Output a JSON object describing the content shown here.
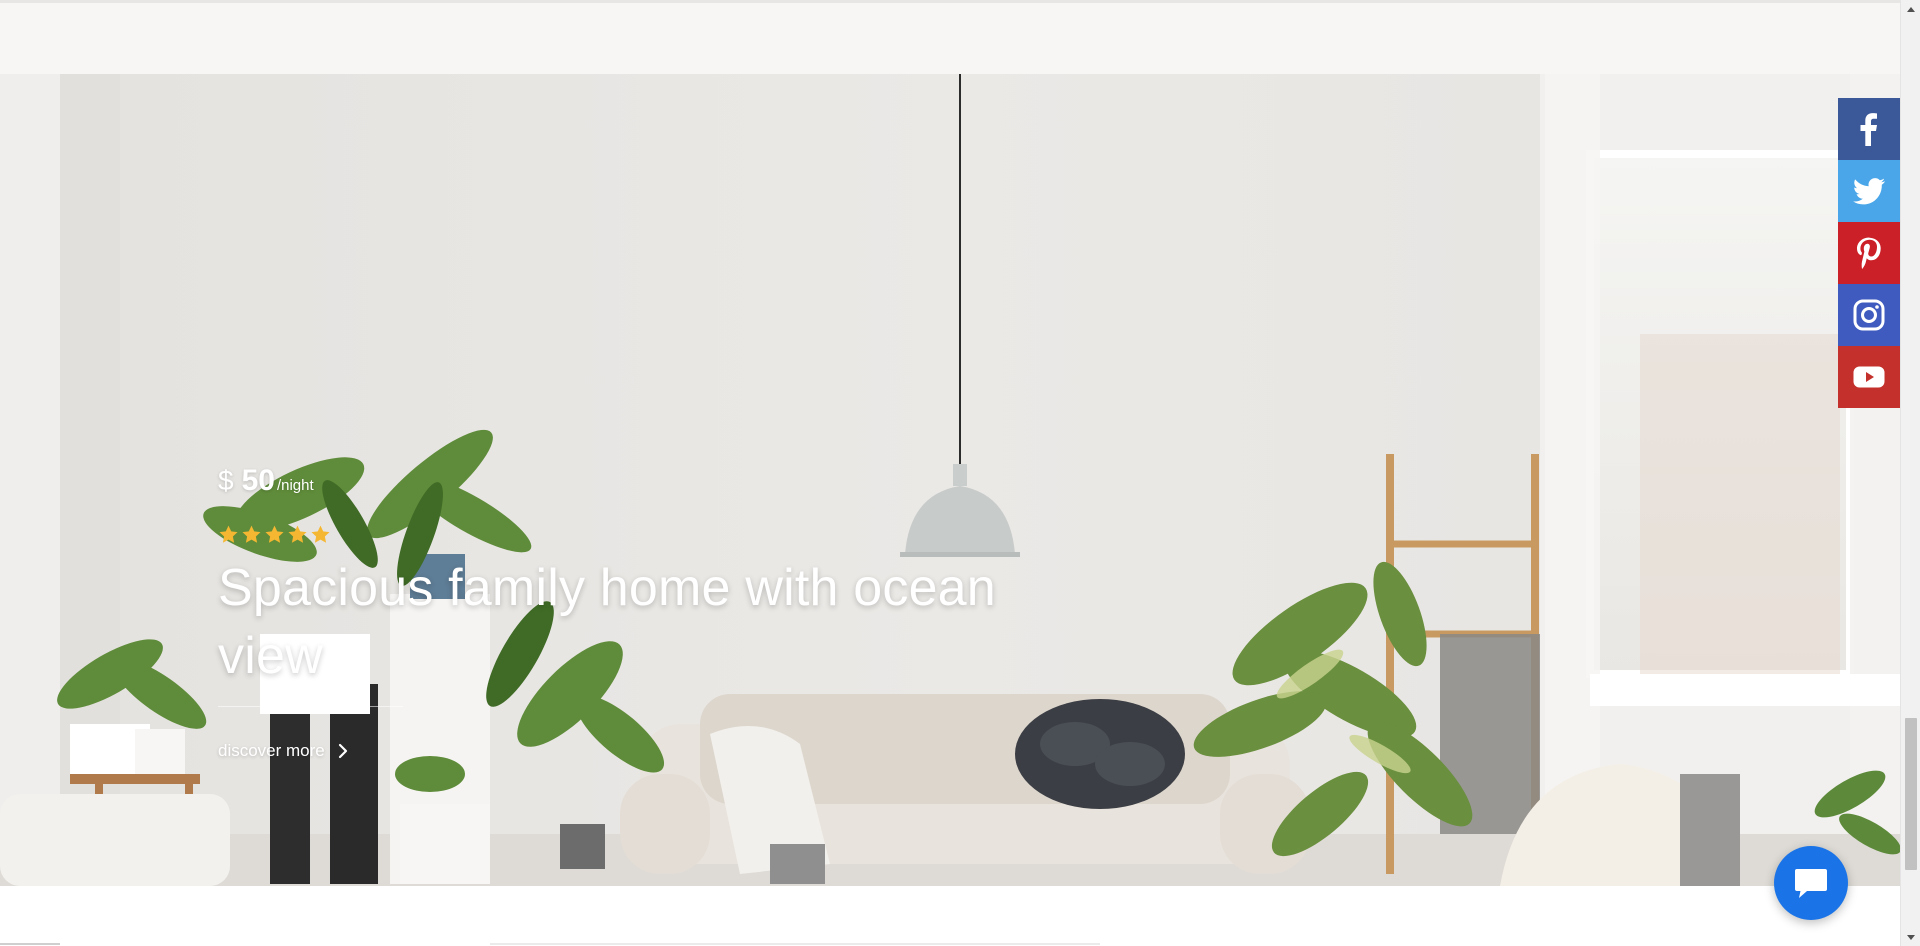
{
  "listing": {
    "currency": "$",
    "price": "50",
    "unit": "/night",
    "rating": 5,
    "title": "Spacious family home with ocean view",
    "cta": "discover more"
  },
  "social": [
    {
      "name": "facebook",
      "icon": "facebook-icon",
      "color": "#3b5998"
    },
    {
      "name": "twitter",
      "icon": "twitter-icon",
      "color": "#4aa6e8"
    },
    {
      "name": "pinterest",
      "icon": "pinterest-icon",
      "color": "#cb2027"
    },
    {
      "name": "instagram",
      "icon": "instagram-icon",
      "color": "#3f5bbf"
    },
    {
      "name": "youtube",
      "icon": "youtube-icon",
      "color": "#c4302b"
    }
  ],
  "chat": {
    "icon": "chat-bubble-icon",
    "color": "#1a74e8"
  },
  "colors": {
    "star": "#f5b731",
    "top_band": "#f8f6f4"
  }
}
